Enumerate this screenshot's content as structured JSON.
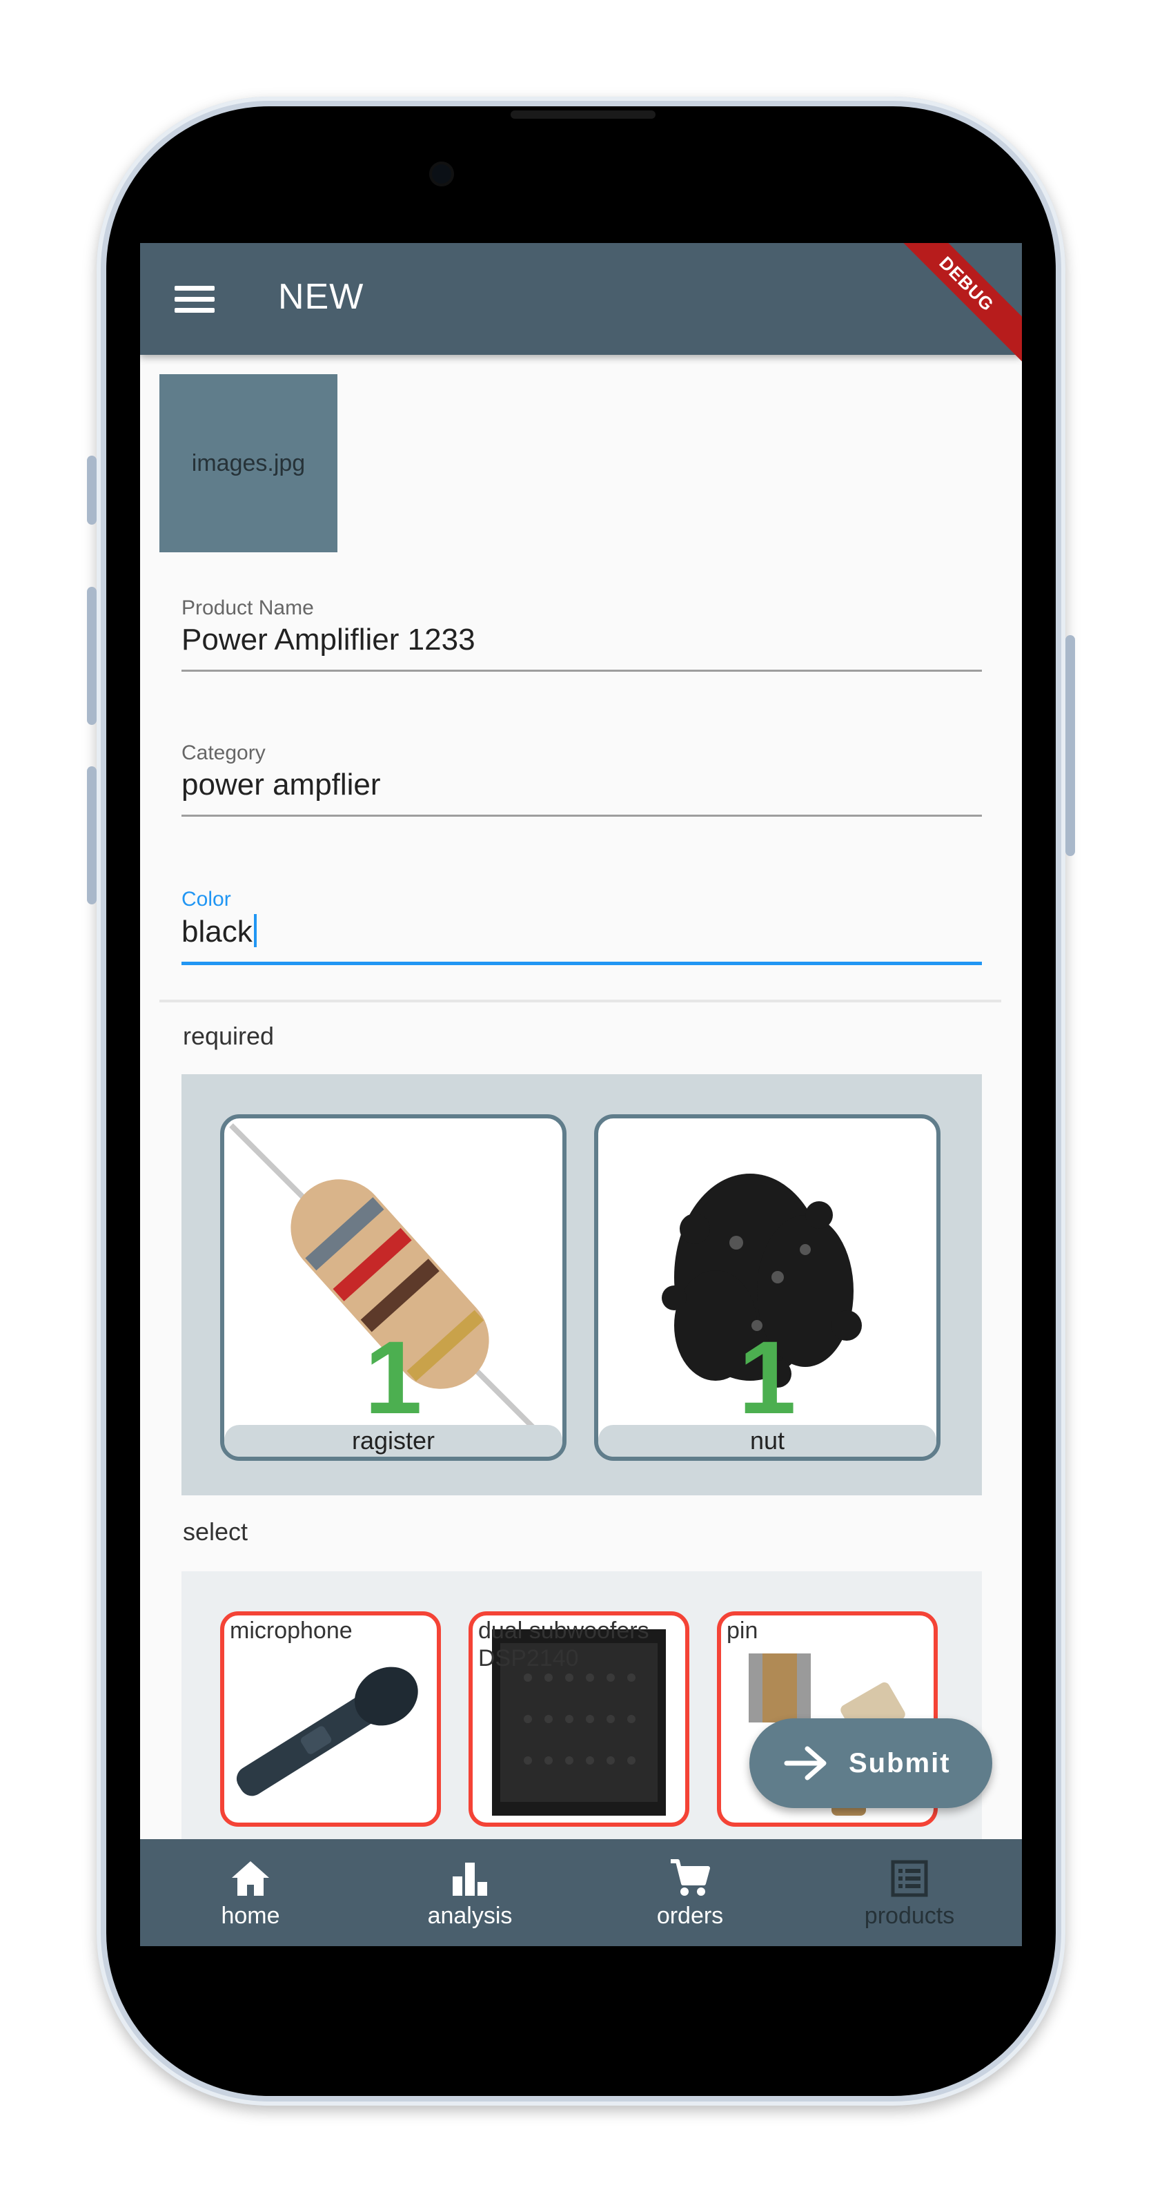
{
  "app_bar": {
    "title": "NEW",
    "debug_banner": "DEBUG"
  },
  "image_picker": {
    "filename": "images.jpg"
  },
  "form": {
    "product_name": {
      "label": "Product Name",
      "value": "Power Ampliflier 1233"
    },
    "category": {
      "label": "Category",
      "value": "power ampflier"
    },
    "color": {
      "label": "Color",
      "value": "black"
    }
  },
  "required": {
    "title": "required",
    "items": [
      {
        "name": "ragister",
        "count": "1"
      },
      {
        "name": "nut",
        "count": "1"
      }
    ]
  },
  "select": {
    "title": "select",
    "items": [
      {
        "name": "microphone"
      },
      {
        "name": "dual subwoofers DSP2140"
      },
      {
        "name": "pin"
      }
    ]
  },
  "fab": {
    "label": "Submit"
  },
  "bottom_nav": {
    "items": [
      {
        "label": "home"
      },
      {
        "label": "analysis"
      },
      {
        "label": "orders"
      },
      {
        "label": "products"
      }
    ]
  },
  "colors": {
    "app_bar": "#4a5f6d",
    "accent_focus": "#2196f3",
    "count_green": "#4caf50",
    "select_border": "#f44336",
    "required_border": "#607d8b"
  }
}
